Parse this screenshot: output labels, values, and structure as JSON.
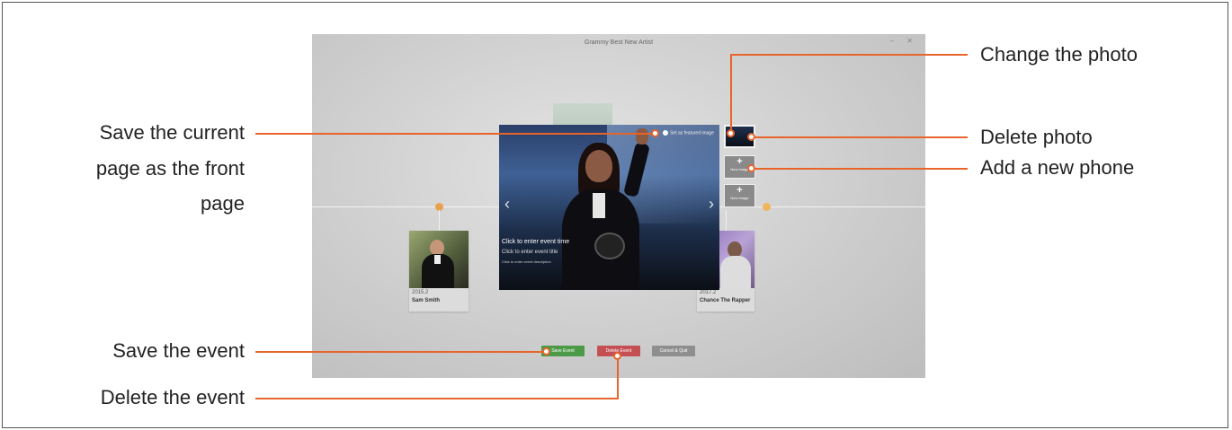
{
  "callouts": {
    "change_photo": "Change the photo",
    "delete_photo": "Delete photo",
    "add_new_phone": "Add a new phone",
    "save_front_line1": "Save the current",
    "save_front_line2": "page as the front",
    "save_front_line3": "page",
    "save_event": "Save the event",
    "delete_event": "Delete the event"
  },
  "app": {
    "title": "Grammy Best New Artist",
    "window_controls": "– ✕"
  },
  "viewer": {
    "featured_label": "Set as featured image",
    "event_time_placeholder": "Click to enter event time",
    "event_title_placeholder": "Click to enter event title",
    "event_description_placeholder": "Click to enter event description",
    "prev_icon": "chevron-left",
    "next_icon": "chevron-right"
  },
  "thumbnails": {
    "new_image_label": "New Image",
    "plus": "+"
  },
  "cards": [
    {
      "date": "2015.2",
      "name": "Sam Smith"
    },
    {
      "date": "2017.2",
      "name": "Chance The Rapper"
    }
  ],
  "buttons": {
    "save": "Save Event",
    "delete": "Delete Event",
    "cancel": "Cancel & Quit"
  },
  "colors": {
    "callout_line": "#e8642a",
    "save_button": "#4c9a48",
    "delete_button": "#c55054",
    "cancel_button": "#8e8e8e",
    "timeline_node": "#e8a04a"
  }
}
